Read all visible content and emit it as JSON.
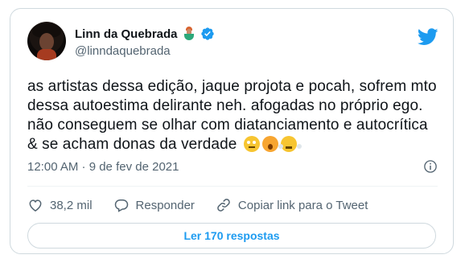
{
  "author": {
    "name": "Linn da Quebrada",
    "handle": "@linndaquebrada",
    "verified": true,
    "emoji_icon": "mermaid-icon"
  },
  "tweet": {
    "text": "as artistas dessa edição, jaque projota e pocah, sofrem mto dessa autoestima delirante neh. afogadas no próprio ego. não conseguem se olhar com diatanciamento e autocrítica & se acham donas da verdade",
    "emojis": [
      "eye-roll-emoji",
      "yawn-emoji",
      "steam-face-emoji"
    ],
    "timestamp": "12:00 AM · 9 de fev de 2021"
  },
  "actions": {
    "like_count": "38,2 mil",
    "reply_label": "Responder",
    "copy_link_label": "Copiar link para o Tweet"
  },
  "footer": {
    "replies_button": "Ler 170 respostas"
  },
  "colors": {
    "accent": "#1d9bf0",
    "text": "#0f1419",
    "muted": "#536471",
    "border": "#cfd9de"
  }
}
